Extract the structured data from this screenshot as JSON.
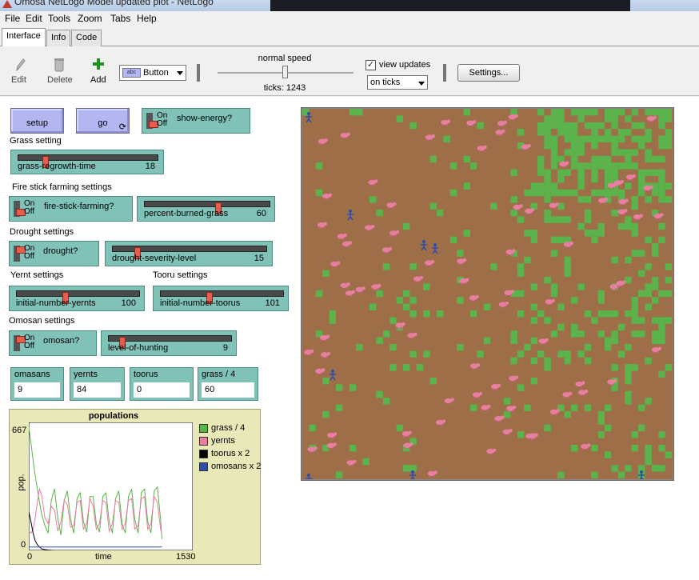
{
  "window": {
    "title": "Omosa NetLogo Model updated plot - NetLogo"
  },
  "menu": [
    "File",
    "Edit",
    "Tools",
    "Zoom",
    "Tabs",
    "Help"
  ],
  "tabs": [
    "Interface",
    "Info",
    "Code"
  ],
  "toolbar": {
    "edit": "Edit",
    "delete": "Delete",
    "add": "Add",
    "widget_type": "Button",
    "speed_label": "normal speed",
    "ticks": "ticks: 1243",
    "view_updates": "view updates",
    "update_mode": "on ticks",
    "settings": "Settings..."
  },
  "widgets": {
    "setup": "setup",
    "go": "go",
    "show_energy": "show-energy?",
    "on": "On",
    "off": "Off",
    "grass_note": "Grass setting",
    "grass_slider": {
      "name": "grass-regrowth-time",
      "value": "18",
      "fraction": 0.18
    },
    "fire_note": "Fire stick farming settings",
    "fire_switch": "fire-stick-farming?",
    "burn_slider": {
      "name": "percent-burned-grass",
      "value": "60",
      "fraction": 0.6
    },
    "drought_note": "Drought settings",
    "drought_switch": "drought?",
    "drought_slider": {
      "name": "drought-severity-level",
      "value": "15",
      "fraction": 0.15
    },
    "yernt_note": "Yernt settings",
    "tooru_note": "Tooru settings",
    "yernt_slider": {
      "name": "initial-number-yernts",
      "value": "100",
      "fraction": 0.4
    },
    "tooru_slider": {
      "name": "initial-number-toorus",
      "value": "101",
      "fraction": 0.4
    },
    "omosan_note": "Omosan settings",
    "omosan_switch": "omosan?",
    "hunting_slider": {
      "name": "level-of-hunting",
      "value": "9",
      "fraction": 0.09
    }
  },
  "monitors": [
    {
      "label": "omasans",
      "value": "9"
    },
    {
      "label": "yernts",
      "value": "84"
    },
    {
      "label": "toorus",
      "value": "0"
    },
    {
      "label": "grass / 4",
      "value": "60"
    }
  ],
  "colors": {
    "grass": "#5ab44b",
    "yernts": "#e87fa0",
    "toorus": "#000000",
    "omosans": "#2f4fa8",
    "patch_brown": "#9d6e47",
    "patch_green": "#5ab44b"
  },
  "chart_data": {
    "type": "line",
    "title": "populations",
    "xlabel": "time",
    "ylabel": "pop.",
    "xlim": [
      0,
      1530
    ],
    "ylim": [
      0,
      667
    ],
    "x_ticks": [
      "0",
      "1530"
    ],
    "y_ticks": [
      "0",
      "667"
    ],
    "series": [
      {
        "name": "grass / 4",
        "x": [
          0,
          20,
          40,
          60,
          80,
          100,
          120,
          150,
          180,
          210,
          240,
          270,
          300,
          330,
          360,
          390,
          420,
          450,
          480,
          510,
          540,
          570,
          600,
          630,
          660,
          690,
          720,
          750,
          780,
          810,
          840,
          870,
          900,
          930,
          960,
          990,
          1020,
          1050,
          1080,
          1110,
          1140,
          1170,
          1200,
          1230,
          1243
        ],
        "values": [
          640,
          560,
          470,
          390,
          320,
          250,
          190,
          130,
          90,
          260,
          320,
          170,
          80,
          260,
          310,
          160,
          90,
          270,
          300,
          150,
          95,
          280,
          280,
          140,
          95,
          280,
          300,
          150,
          90,
          270,
          310,
          140,
          90,
          280,
          320,
          160,
          90,
          300,
          320,
          150,
          90,
          310,
          330,
          160,
          60
        ]
      },
      {
        "name": "yernts",
        "x": [
          0,
          20,
          40,
          60,
          80,
          100,
          120,
          150,
          180,
          210,
          240,
          270,
          300,
          330,
          360,
          390,
          420,
          450,
          480,
          510,
          540,
          570,
          600,
          630,
          660,
          690,
          720,
          750,
          780,
          810,
          840,
          870,
          900,
          930,
          960,
          990,
          1020,
          1050,
          1080,
          1110,
          1140,
          1170,
          1200,
          1230,
          1243
        ],
        "values": [
          100,
          90,
          110,
          170,
          250,
          320,
          290,
          170,
          140,
          230,
          210,
          100,
          150,
          260,
          240,
          120,
          130,
          250,
          260,
          110,
          140,
          270,
          230,
          110,
          140,
          260,
          250,
          100,
          140,
          260,
          250,
          110,
          140,
          260,
          270,
          110,
          130,
          270,
          280,
          110,
          140,
          280,
          250,
          110,
          84
        ]
      },
      {
        "name": "toorus x 2",
        "x": [
          0,
          20,
          40,
          60,
          80,
          100,
          120,
          150,
          180,
          210,
          240,
          270,
          300,
          1243
        ],
        "values": [
          202,
          150,
          90,
          50,
          30,
          18,
          8,
          4,
          2,
          1,
          0,
          0,
          0,
          0
        ]
      },
      {
        "name": "omosans x 2",
        "x": [
          0,
          100,
          200,
          1243
        ],
        "values": [
          18,
          18,
          18,
          18
        ]
      }
    ]
  }
}
